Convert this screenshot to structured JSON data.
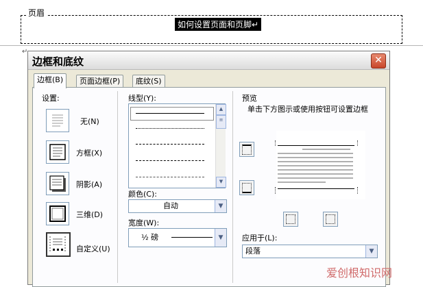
{
  "document": {
    "header_tag": "页眉",
    "header_text": "如何设置页面和页脚↵",
    "paragraph_mark": "↵"
  },
  "dialog": {
    "title": "边框和底纹",
    "close_label": "✕",
    "tabs": [
      {
        "label": "边框(B)"
      },
      {
        "label": "页面边框(P)"
      },
      {
        "label": "底纹(S)"
      }
    ],
    "settings": {
      "label": "设置:",
      "presets": [
        {
          "label": "无(N)"
        },
        {
          "label": "方框(X)"
        },
        {
          "label": "阴影(A)"
        },
        {
          "label": "三维(D)"
        },
        {
          "label": "自定义(U)"
        }
      ]
    },
    "style": {
      "label": "线型(Y):"
    },
    "color": {
      "label": "颜色(C):",
      "value": "自动"
    },
    "width": {
      "label": "宽度(W):",
      "value": "½ 磅"
    },
    "preview": {
      "label": "预览",
      "hint": "单击下方图示或使用按钮可设置边框"
    },
    "apply_to": {
      "label": "应用于(L):",
      "value": "段落"
    }
  },
  "watermark": "爱创根知识网"
}
